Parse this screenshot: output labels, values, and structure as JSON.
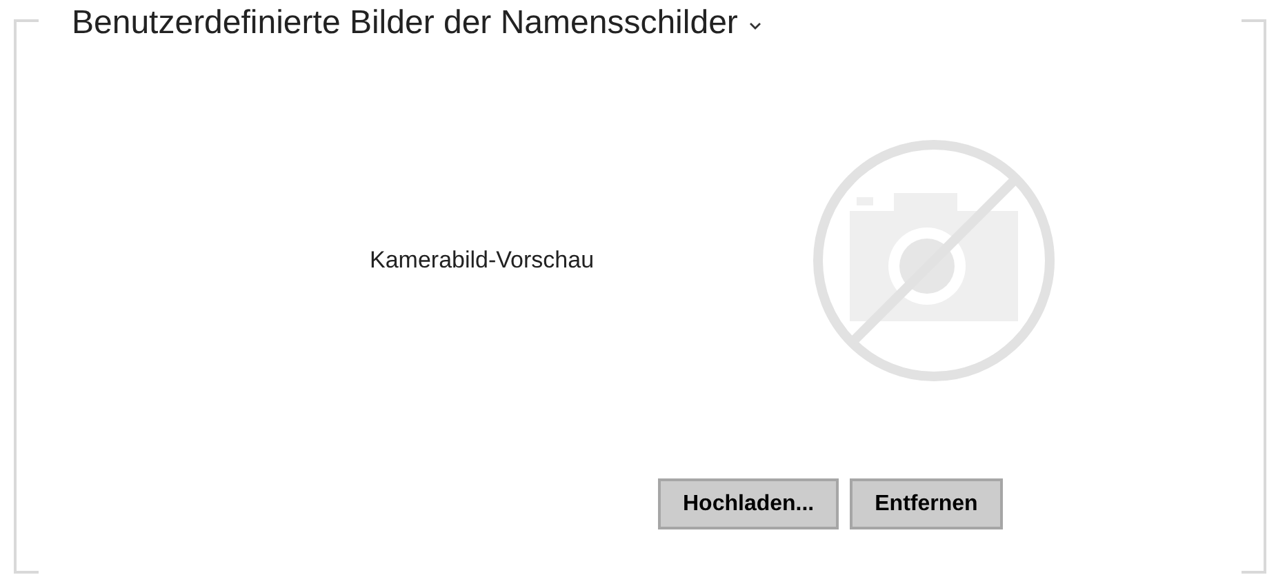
{
  "section": {
    "title": "Benutzerdefinierte Bilder der Namensschilder",
    "expanded": true
  },
  "preview": {
    "label": "Kamerabild-Vorschau"
  },
  "buttons": [
    "Hochladen...",
    "Entfernen"
  ]
}
